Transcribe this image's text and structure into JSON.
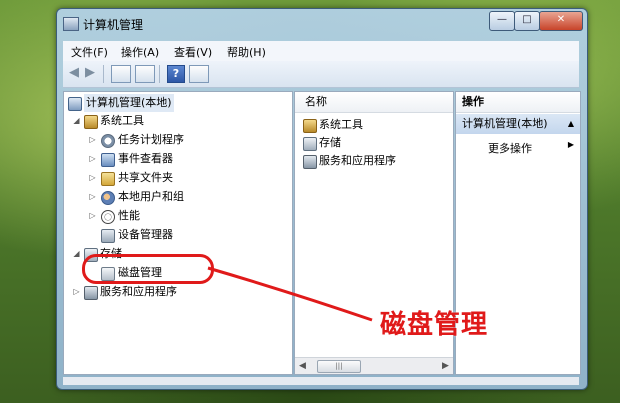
{
  "window": {
    "title": "计算机管理"
  },
  "window_controls": {
    "minimize": "—",
    "maximize": "□",
    "close": "✕"
  },
  "menu": [
    "文件(F)",
    "操作(A)",
    "查看(V)",
    "帮助(H)"
  ],
  "toolbar": {
    "help": "?"
  },
  "tree": {
    "root": "计算机管理(本地)",
    "items": [
      {
        "label": "系统工具",
        "icon": "tools-icon",
        "level": 1
      },
      {
        "label": "任务计划程序",
        "icon": "clock-icon",
        "level": 2
      },
      {
        "label": "事件查看器",
        "icon": "event-viewer-icon",
        "level": 2
      },
      {
        "label": "共享文件夹",
        "icon": "shared-folder-icon",
        "level": 2
      },
      {
        "label": "本地用户和组",
        "icon": "users-icon",
        "level": 2
      },
      {
        "label": "性能",
        "icon": "performance-icon",
        "level": 2
      },
      {
        "label": "设备管理器",
        "icon": "device-manager-icon",
        "level": 2
      },
      {
        "label": "存储",
        "icon": "storage-icon",
        "level": 1
      },
      {
        "label": "磁盘管理",
        "icon": "disk-icon",
        "level": 2
      },
      {
        "label": "服务和应用程序",
        "icon": "services-icon",
        "level": 1
      }
    ]
  },
  "list": {
    "header": "名称",
    "items": [
      "系统工具",
      "存储",
      "服务和应用程序"
    ]
  },
  "actions": {
    "header": "操作",
    "section": "计算机管理(本地)",
    "more": "更多操作"
  },
  "annotation": {
    "label": "磁盘管理",
    "color": "#e01a1a"
  }
}
